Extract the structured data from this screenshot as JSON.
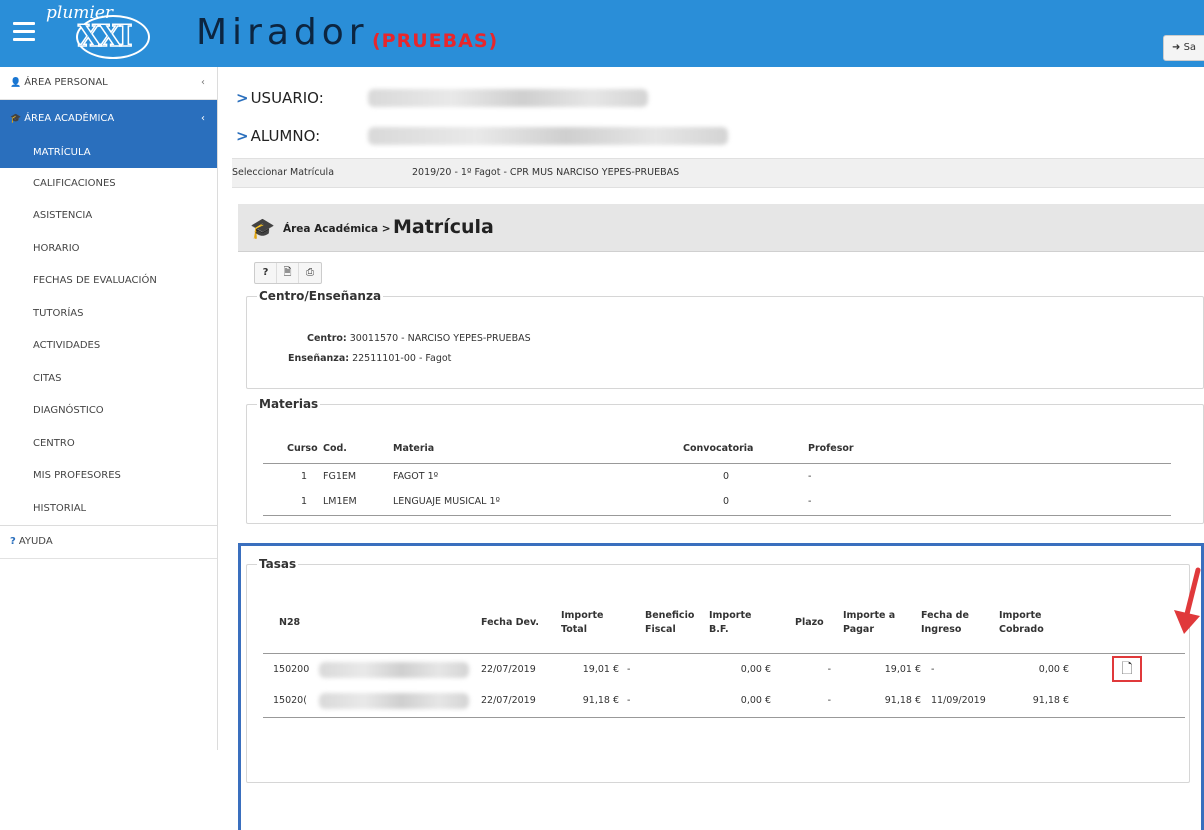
{
  "header": {
    "logo_text": "plumier",
    "logo_xxi": "XXI",
    "app_title": "Mirador",
    "app_badge": "(PRUEBAS)",
    "logout_label": "Sa",
    "brand_color": "#2a8ed8",
    "badge_color": "#e8262c"
  },
  "sidebar": {
    "personal": "ÁREA PERSONAL",
    "academica": "ÁREA ACADÉMICA",
    "items": [
      "MATRÍCULA",
      "CALIFICACIONES",
      "ASISTENCIA",
      "HORARIO",
      "FECHAS DE EVALUACIÓN",
      "TUTORÍAS",
      "ACTIVIDADES",
      "CITAS",
      "DIAGNÓSTICO",
      "CENTRO",
      "MIS PROFESORES",
      "HISTORIAL"
    ],
    "ayuda": "AYUDA",
    "chevron": "‹",
    "active_color": "#2a6fbd"
  },
  "user": {
    "usuario_label": "USUARIO:",
    "alumno_label": "ALUMNO:"
  },
  "select": {
    "label": "Seleccionar Matrícula",
    "value": "2019/20 - 1º Fagot - CPR MUS NARCISO YEPES-PRUEBAS"
  },
  "breadcrumb": {
    "parent": "Área Académica >",
    "current": "Matrícula"
  },
  "toolbar": {
    "help": "?",
    "doc": "🗎",
    "print": "⎙"
  },
  "centro": {
    "legend": "Centro/Enseñanza",
    "centro_label": "Centro:",
    "centro_value": "30011570 - NARCISO YEPES-PRUEBAS",
    "ensenanza_label": "Enseñanza:",
    "ensenanza_value": "22511101-00 - Fagot"
  },
  "materias": {
    "legend": "Materias",
    "headers": [
      "Curso",
      "Cod.",
      "Materia",
      "Convocatoria",
      "Profesor"
    ],
    "rows": [
      [
        "1",
        "FG1EM",
        "FAGOT 1º",
        "0",
        "-"
      ],
      [
        "1",
        "LM1EM",
        "LENGUAJE MUSICAL 1º",
        "0",
        "-"
      ]
    ]
  },
  "tasas": {
    "legend": "Tasas",
    "headers": {
      "n28": "N28",
      "fecha_dev": "Fecha Dev.",
      "importe_total": "Importe Total",
      "beneficio": "Beneficio Fiscal",
      "importe_bf": "Importe B.F.",
      "plazo": "Plazo",
      "importe_pagar": "Importe a Pagar",
      "fecha_ingreso": "Fecha de Ingreso",
      "importe_cobrado": "Importe Cobrado"
    },
    "rows": [
      {
        "n28": "150200",
        "fecha_dev": "22/07/2019",
        "importe_total": "19,01 €",
        "beneficio": "-",
        "importe_bf": "0,00 €",
        "plazo": "-",
        "importe_pagar": "19,01 €",
        "fecha_ingreso": "-",
        "importe_cobrado": "0,00 €"
      },
      {
        "n28": "15020(",
        "fecha_dev": "22/07/2019",
        "importe_total": "91,18 €",
        "beneficio": "-",
        "importe_bf": "0,00 €",
        "plazo": "-",
        "importe_pagar": "91,18 €",
        "fecha_ingreso": "11/09/2019",
        "importe_cobrado": "91,18 €"
      }
    ],
    "doc_icon": "🗋",
    "highlight_color": "#3a6fbe",
    "arrow_color": "#e0393b"
  }
}
